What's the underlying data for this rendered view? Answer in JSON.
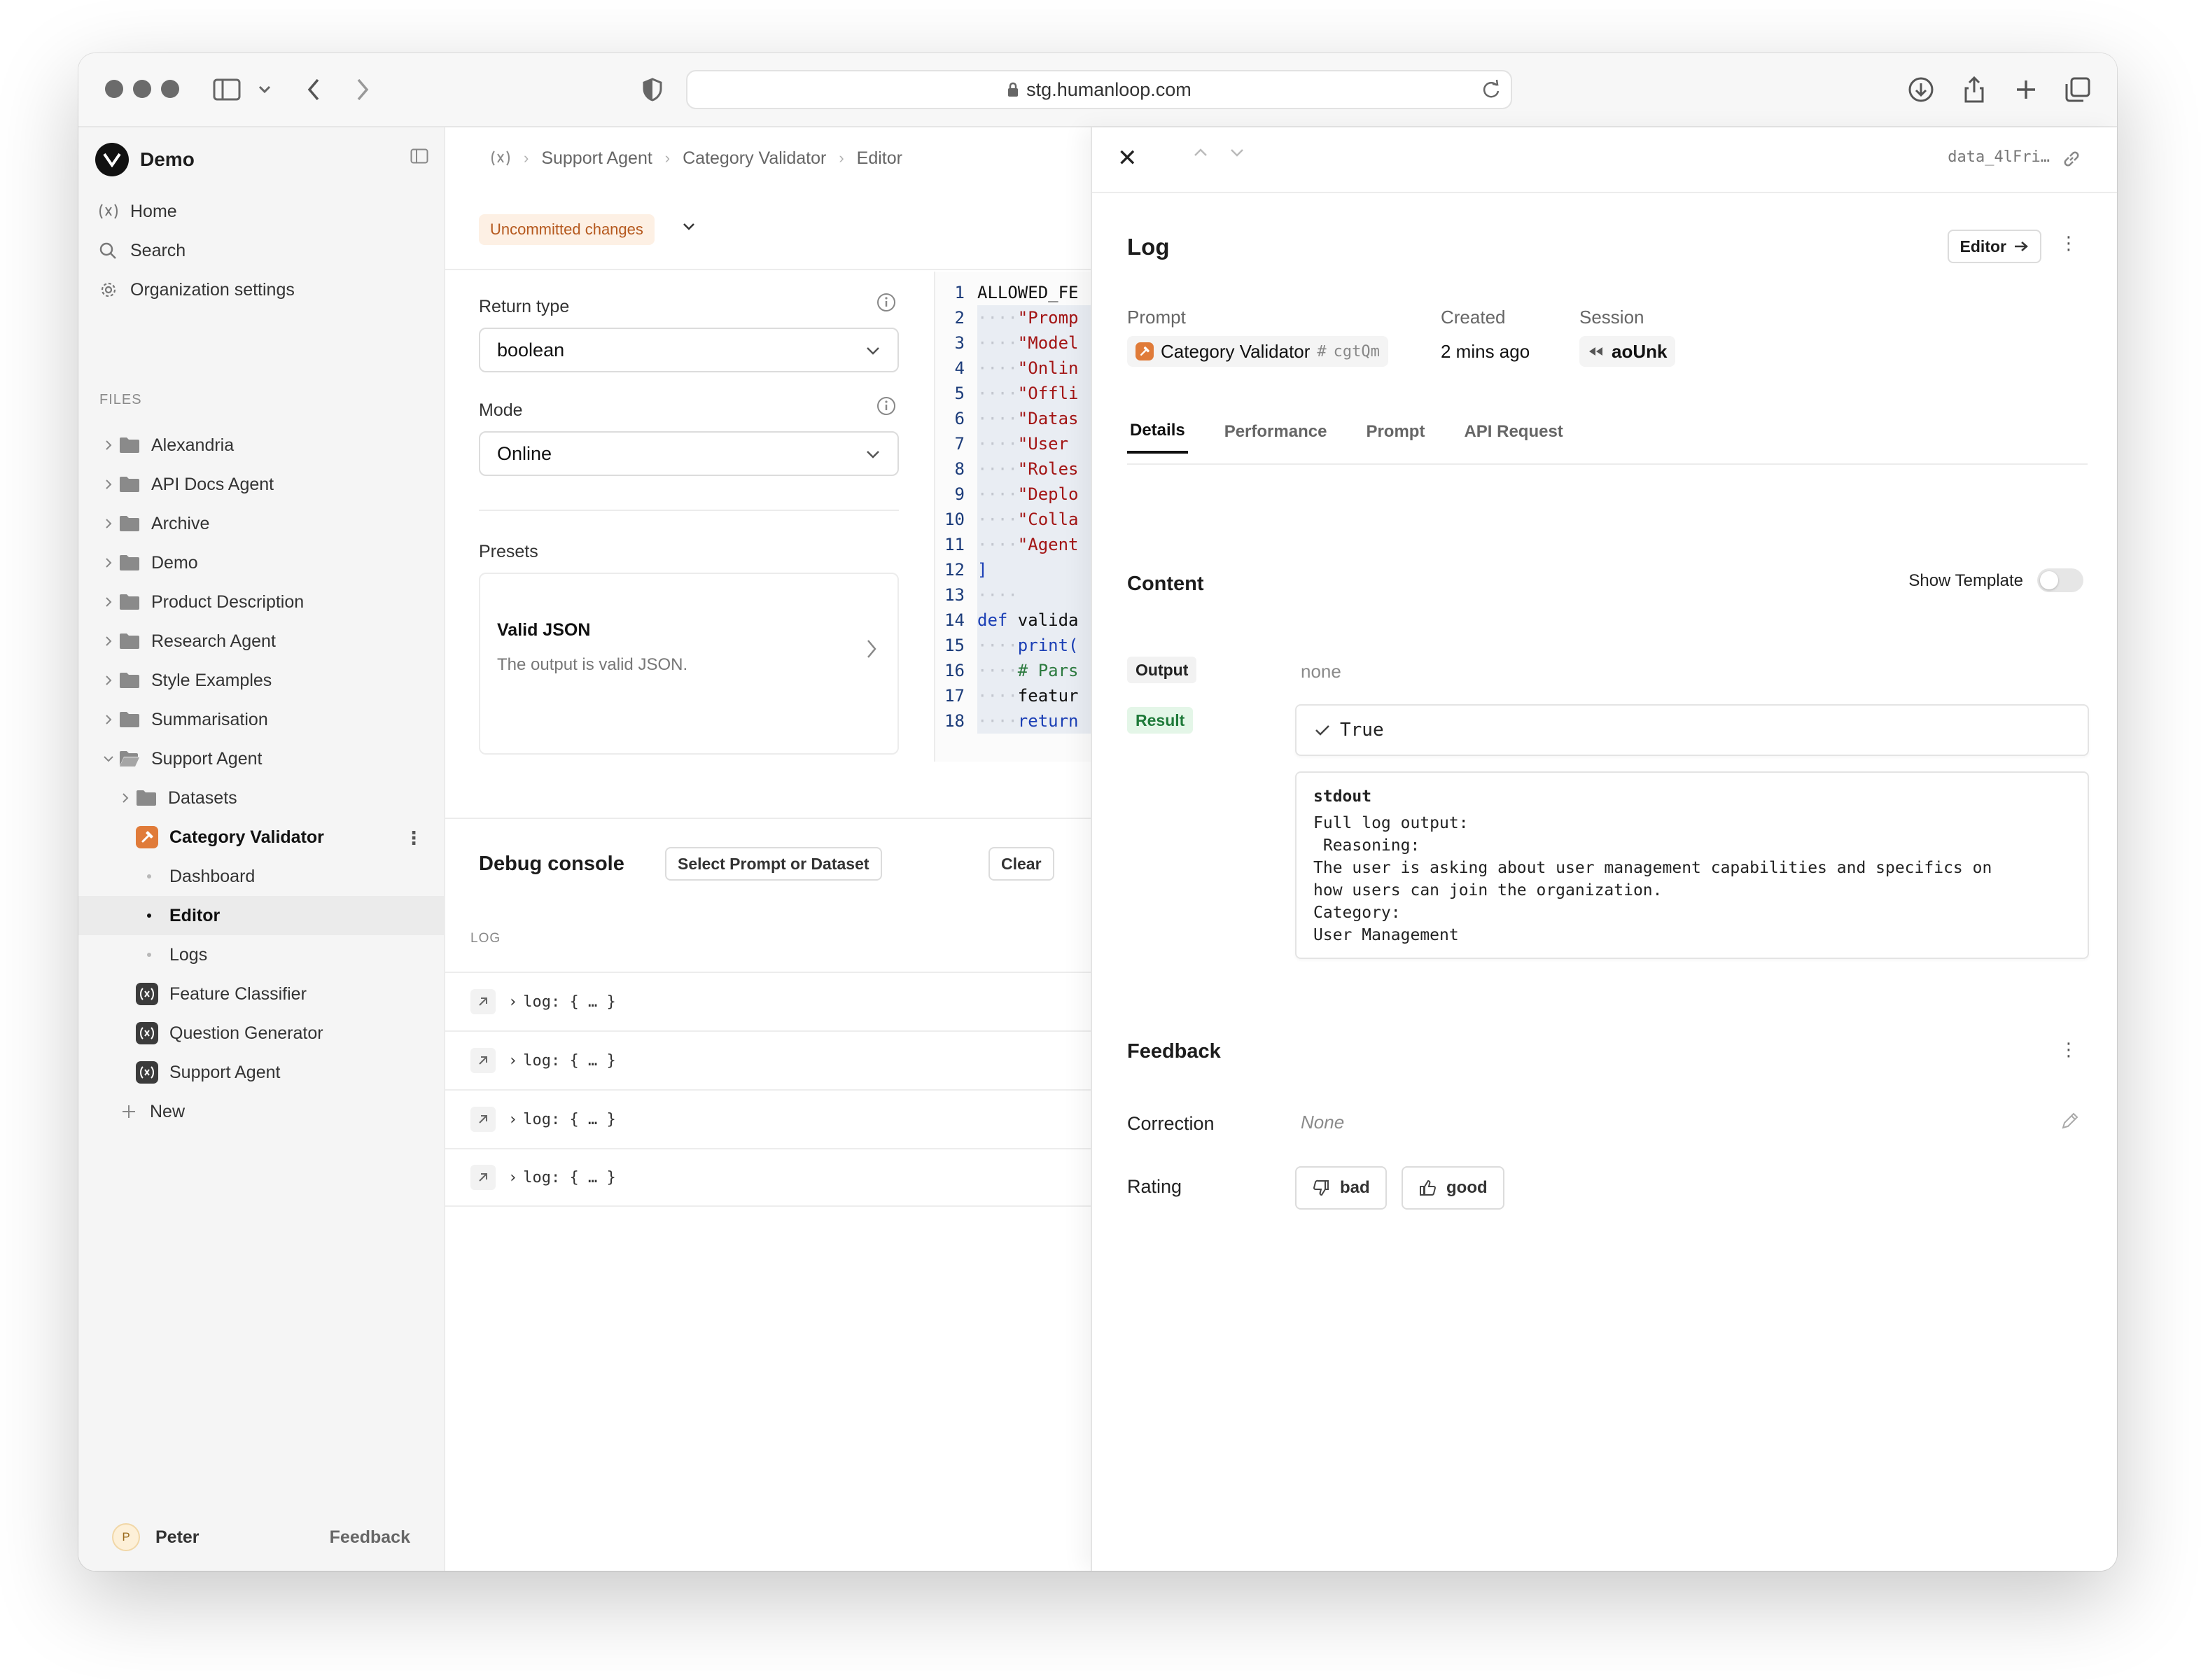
{
  "browser": {
    "url": "stg.humanloop.com"
  },
  "sidebar": {
    "org_name": "Demo",
    "nav": [
      {
        "label": "Home",
        "icon": "function-icon"
      },
      {
        "label": "Search",
        "icon": "search-icon"
      },
      {
        "label": "Organization settings",
        "icon": "gear-icon"
      }
    ],
    "files_label": "FILES",
    "tree": [
      {
        "label": "Alexandria",
        "type": "folder"
      },
      {
        "label": "API Docs Agent",
        "type": "folder"
      },
      {
        "label": "Archive",
        "type": "folder"
      },
      {
        "label": "Demo",
        "type": "folder"
      },
      {
        "label": "Product Description",
        "type": "folder"
      },
      {
        "label": "Research Agent",
        "type": "folder"
      },
      {
        "label": "Style Examples",
        "type": "folder"
      },
      {
        "label": "Summarisation",
        "type": "folder"
      },
      {
        "label": "Support Agent",
        "type": "folder-open"
      },
      {
        "label": "Datasets",
        "type": "folder"
      },
      {
        "label": "Category Validator",
        "type": "evaluator"
      },
      {
        "label": "Dashboard",
        "type": "page"
      },
      {
        "label": "Editor",
        "type": "page",
        "selected": true
      },
      {
        "label": "Logs",
        "type": "page"
      },
      {
        "label": "Feature Classifier",
        "type": "flow"
      },
      {
        "label": "Question Generator",
        "type": "flow"
      },
      {
        "label": "Support Agent",
        "type": "flow"
      },
      {
        "label": "New",
        "type": "new"
      }
    ],
    "user_initial": "P",
    "user_name": "Peter",
    "feedback_label": "Feedback"
  },
  "main": {
    "breadcrumb": [
      "Support Agent",
      "Category Validator",
      "Editor"
    ],
    "uncommitted_label": "Uncommitted changes",
    "return_type_label": "Return type",
    "return_type_value": "boolean",
    "mode_label": "Mode",
    "mode_value": "Online",
    "presets_label": "Presets",
    "preset": {
      "title": "Valid JSON",
      "description": "The output is valid JSON."
    },
    "code_lines": [
      {
        "n": "1",
        "parts": [
          [
            "ALLOWED_FE",
            "code-text"
          ]
        ]
      },
      {
        "n": "2",
        "parts": [
          [
            "····",
            "ln-dots"
          ],
          [
            "\"Promp",
            "str"
          ]
        ]
      },
      {
        "n": "3",
        "parts": [
          [
            "····",
            "ln-dots"
          ],
          [
            "\"Model",
            "str"
          ]
        ]
      },
      {
        "n": "4",
        "parts": [
          [
            "····",
            "ln-dots"
          ],
          [
            "\"Onlin",
            "str"
          ]
        ]
      },
      {
        "n": "5",
        "parts": [
          [
            "····",
            "ln-dots"
          ],
          [
            "\"Offli",
            "str"
          ]
        ]
      },
      {
        "n": "6",
        "parts": [
          [
            "····",
            "ln-dots"
          ],
          [
            "\"Datas",
            "str"
          ]
        ]
      },
      {
        "n": "7",
        "parts": [
          [
            "····",
            "ln-dots"
          ],
          [
            "\"User ",
            "str"
          ]
        ]
      },
      {
        "n": "8",
        "parts": [
          [
            "····",
            "ln-dots"
          ],
          [
            "\"Roles",
            "str"
          ]
        ]
      },
      {
        "n": "9",
        "parts": [
          [
            "····",
            "ln-dots"
          ],
          [
            "\"Deplo",
            "str"
          ]
        ]
      },
      {
        "n": "10",
        "parts": [
          [
            "····",
            "ln-dots"
          ],
          [
            "\"Colla",
            "str"
          ]
        ]
      },
      {
        "n": "11",
        "parts": [
          [
            "····",
            "ln-dots"
          ],
          [
            "\"Agent",
            "str"
          ]
        ]
      },
      {
        "n": "12",
        "parts": [
          [
            "]",
            "kw"
          ]
        ]
      },
      {
        "n": "13",
        "parts": [
          [
            "····",
            "ln-dots"
          ]
        ]
      },
      {
        "n": "14",
        "parts": [
          [
            "def ",
            "kw"
          ],
          [
            "valida",
            "code-text"
          ]
        ]
      },
      {
        "n": "15",
        "parts": [
          [
            "····",
            "ln-dots"
          ],
          [
            "print(",
            "kw"
          ]
        ]
      },
      {
        "n": "16",
        "parts": [
          [
            "····",
            "ln-dots"
          ],
          [
            "# Pars",
            "cmt"
          ]
        ]
      },
      {
        "n": "17",
        "parts": [
          [
            "····",
            "ln-dots"
          ],
          [
            "featur",
            "code-text"
          ]
        ]
      },
      {
        "n": "18",
        "parts": [
          [
            "····",
            "ln-dots"
          ],
          [
            "return",
            "kw"
          ]
        ]
      }
    ],
    "debug_title": "Debug console",
    "select_button": "Select Prompt or Dataset",
    "clear_button": "Clear",
    "log_header": "LOG",
    "log_rows": [
      "log: { … }",
      "log: { … }",
      "log: { … }",
      "log: { … }"
    ]
  },
  "detail": {
    "log_id": "data_4lFri…",
    "title": "Log",
    "editor_button": "Editor",
    "prompt_label": "Prompt",
    "prompt_name": "Category Validator",
    "prompt_hash": "cgtQm",
    "created_label": "Created",
    "created_value": "2 mins ago",
    "session_label": "Session",
    "session_value": "aoUnk",
    "tabs": [
      "Details",
      "Performance",
      "Prompt",
      "API Request"
    ],
    "content_title": "Content",
    "show_template_label": "Show Template",
    "output_label": "Output",
    "output_value": "none",
    "result_label": "Result",
    "result_value": "True",
    "stdout_title": "stdout",
    "stdout_body": "Full log output:\n Reasoning:\nThe user is asking about user management capabilities and specifics on\nhow users can join the organization.\nCategory:\nUser Management",
    "feedback_title": "Feedback",
    "correction_label": "Correction",
    "correction_value": "None",
    "rating_label": "Rating",
    "bad_label": "bad",
    "good_label": "good"
  }
}
